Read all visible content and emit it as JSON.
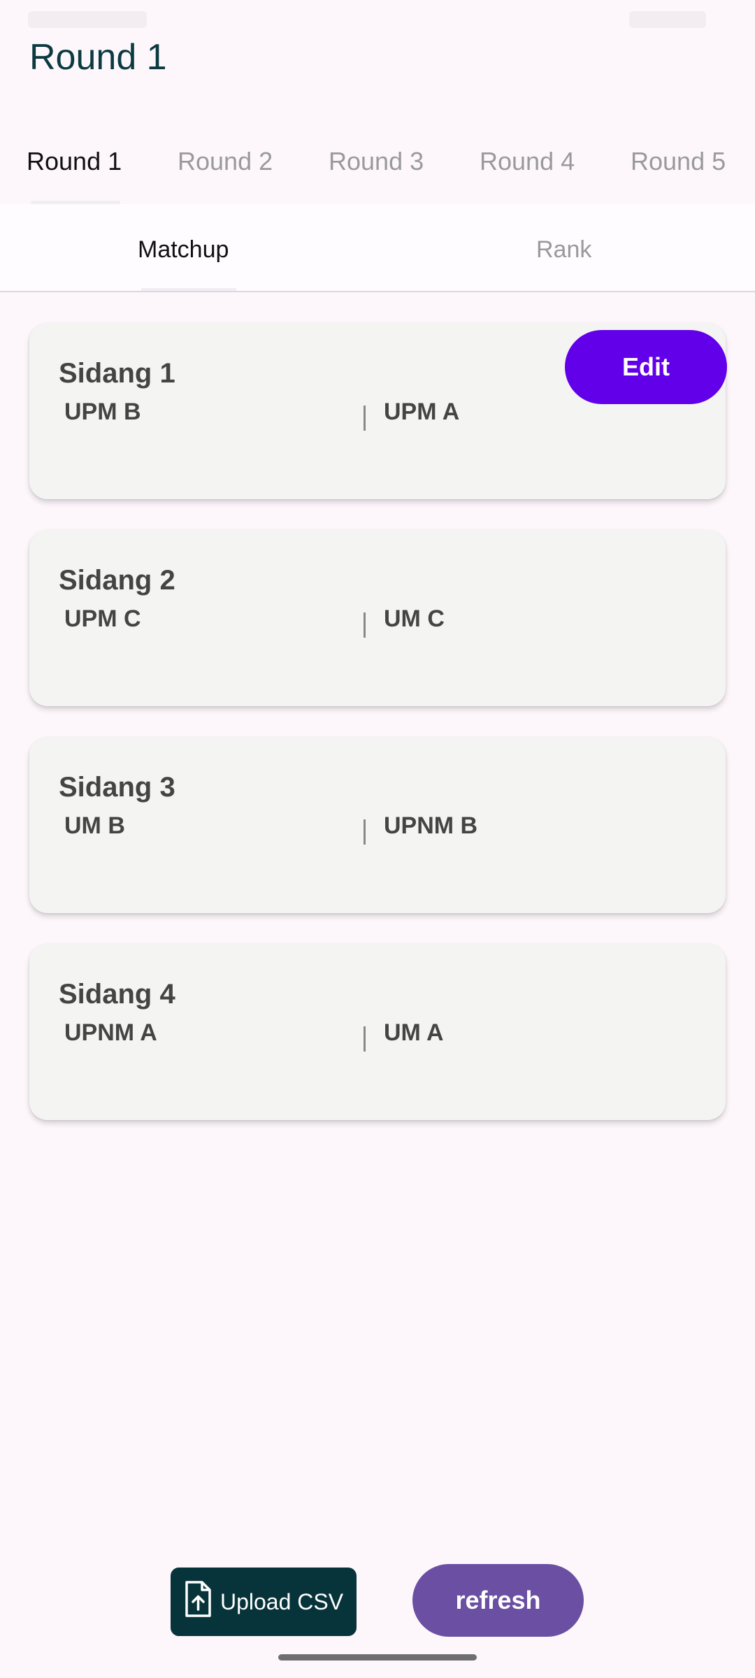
{
  "app_bar": {
    "title": "Round 1"
  },
  "round_tabs": [
    {
      "label": "Round 1"
    },
    {
      "label": "Round 2"
    },
    {
      "label": "Round 3"
    },
    {
      "label": "Round 4"
    },
    {
      "label": "Round 5"
    }
  ],
  "sub_tabs": [
    {
      "label": "Matchup"
    },
    {
      "label": "Rank"
    }
  ],
  "matchups": [
    {
      "title": "Sidang 1",
      "team_a": "UPM B",
      "team_b": "UPM A"
    },
    {
      "title": "Sidang 2",
      "team_a": "UPM C",
      "team_b": "UM C"
    },
    {
      "title": "Sidang 3",
      "team_a": "UM B",
      "team_b": "UPNM B"
    },
    {
      "title": "Sidang 4",
      "team_a": "UPNM A",
      "team_b": "UM A"
    }
  ],
  "edit_button": {
    "label": "Edit"
  },
  "footer": {
    "upload_label": "Upload CSV",
    "upload_icon": "file-upload-icon",
    "refresh_label": "refresh"
  },
  "colors": {
    "primary_purple": "#6200ea",
    "refresh_purple": "#6a4fa3",
    "upload_teal": "#07343a",
    "title_teal": "#0b3a40"
  }
}
